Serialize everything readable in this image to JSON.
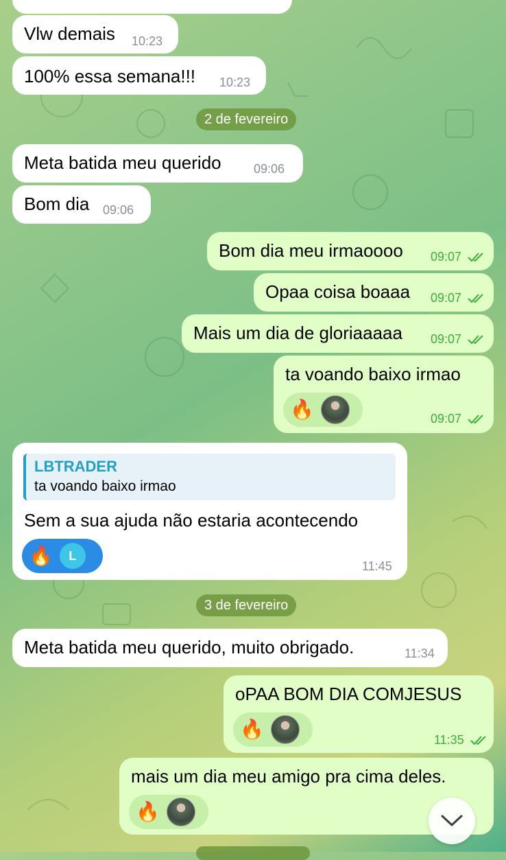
{
  "messages": [
    {
      "text": "Vlw demais",
      "time": "10:23"
    },
    {
      "text": "100% essa semana!!!",
      "time": "10:23"
    },
    {
      "text": "Meta batida meu querido",
      "time": "09:06"
    },
    {
      "text": "Bom dia",
      "time": "09:06"
    },
    {
      "text": "Bom dia meu irmaoooo",
      "time": "09:07"
    },
    {
      "text": "Opaa coisa boaaa",
      "time": "09:07"
    },
    {
      "text": "Mais um dia de gloriaaaaa",
      "time": "09:07"
    },
    {
      "text": "ta voando baixo irmao",
      "time": "09:07"
    },
    {
      "text": "Sem a sua ajuda não estaria acontecendo",
      "time": "11:45"
    },
    {
      "text": "Meta batida meu querido, muito obrigado.",
      "time": "11:34"
    },
    {
      "text": "oPAA BOM DIA COMJESUS",
      "time": "11:35"
    },
    {
      "text": "mais um dia meu amigo pra cima deles.",
      "time": ""
    }
  ],
  "date_separators": [
    "2 de fevereiro",
    "3 de fevereiro"
  ],
  "reply_quote": {
    "name": "LBTRADER",
    "text": "ta voando baixo irmao"
  },
  "reaction": {
    "emoji": "🔥",
    "avatar_letter": "L"
  },
  "colors": {
    "incoming": "#ffffff",
    "outgoing": "#e1fec6",
    "time_outgoing": "#3aae3c",
    "quote_accent": "#1fa0c4",
    "reaction_blue": "#2b8ce6"
  },
  "icons": {
    "read_receipt": "double-check-icon",
    "scroll_down": "chevron-down-icon"
  }
}
